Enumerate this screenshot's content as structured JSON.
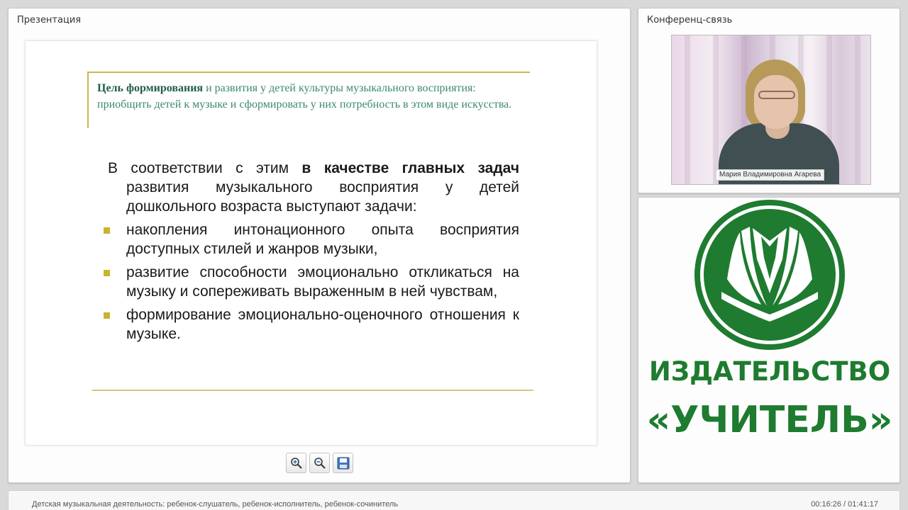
{
  "presentation_panel": {
    "title": "Презентация",
    "slide": {
      "goal_bold": "Цель формирования",
      "goal_rest": " и развития у детей культуры музыкального восприятия: приобщить детей к музыке и сформировать у них потребность в этом виде искусства.",
      "intro_plain": "В соответствии с этим ",
      "intro_bold": "в качестве главных задач",
      "intro_rest": " развития музыкального восприятия у детей дошкольного возраста выступают задачи:",
      "bullets": [
        "накопления интонационного опыта восприятия доступных стилей и жанров музыки,",
        "развитие способности эмоционально откликаться на музыку и сопереживать выраженным в ней чувствам,",
        "формирование эмоционально-оценочного отношения к музыке."
      ]
    },
    "toolbar": {
      "zoom_in_icon": "zoom-in-icon",
      "zoom_out_icon": "zoom-out-icon",
      "save_icon": "save-icon"
    }
  },
  "conference_panel": {
    "title": "Конференц-связь",
    "participant_name": "Мария Владимировна Агарева"
  },
  "publisher_panel": {
    "line1": "ИЗДАТЕЛЬСТВО",
    "line2": "«УЧИТЕЛЬ»",
    "brand_color": "#1e7b2f"
  },
  "status_bar": {
    "webinar_title": "Детская музыкальная деятельность: ребенок-слушатель, ребенок-исполнитель, ребенок-сочинитель",
    "time": "00:16:26 / 01:41:17"
  }
}
